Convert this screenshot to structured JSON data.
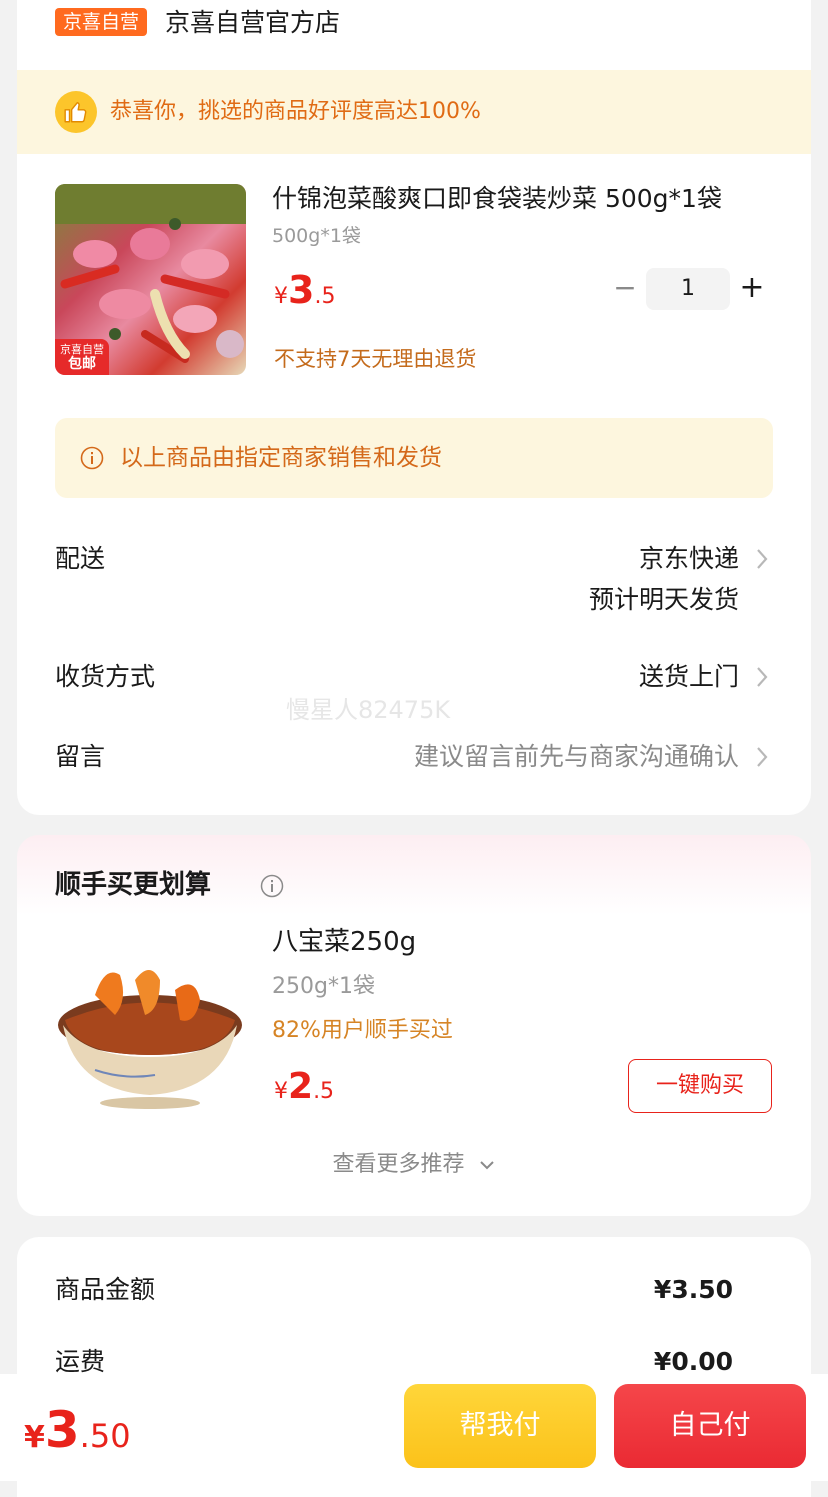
{
  "store": {
    "tag": "京喜自营",
    "name": "京喜自营官方店"
  },
  "rating_banner": {
    "text": "恭喜你，挑选的商品好评度高达100%"
  },
  "product": {
    "title": "什锦泡菜酸爽口即食袋装炒菜 500g*1袋",
    "spec": "500g*1袋",
    "price_symbol": "¥",
    "price_int": "3",
    "price_dec": ".5",
    "quantity": "1",
    "minus": "−",
    "plus": "+",
    "return_policy": "不支持7天无理由退货",
    "image_badge_top": "京喜自营",
    "image_badge_bottom": "包邮"
  },
  "notice": {
    "text": "以上商品由指定商家销售和发货"
  },
  "rows": {
    "delivery_label": "配送",
    "delivery_value": "京东快递",
    "delivery_sub": "预计明天发货",
    "receive_label": "收货方式",
    "receive_value": "送货上门",
    "message_label": "留言",
    "message_placeholder": "建议留言前先与商家沟通确认"
  },
  "watermark": "慢星人82475K",
  "recommend": {
    "title": "顺手买更划算",
    "name": "八宝菜250g",
    "spec": "250g*1袋",
    "bought": "82%用户顺手买过",
    "price_symbol": "¥",
    "price_int": "2",
    "price_dec": ".5",
    "buy_label": "一键购买",
    "more_label": "查看更多推荐"
  },
  "summary": {
    "goods_label": "商品金额",
    "goods_value": "¥3.50",
    "shipping_label": "运费",
    "shipping_value": "¥0.00"
  },
  "bottom": {
    "total_symbol": "¥",
    "total_int": "3",
    "total_dec": ".50",
    "help_pay": "帮我付",
    "self_pay": "自己付"
  },
  "colors": {
    "accent_red": "#e8231b",
    "orange_tag": "#ff6a1f",
    "banner_bg": "#fdf6de",
    "yellow_btn": "#fbc21a"
  }
}
